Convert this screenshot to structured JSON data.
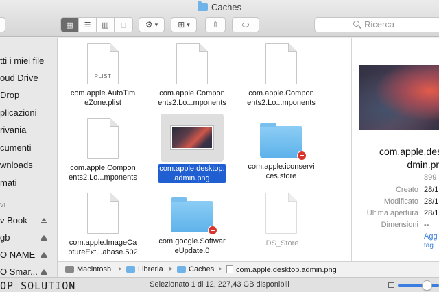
{
  "window": {
    "title": "Caches"
  },
  "toolbar": {
    "view_icons": "▦",
    "view_list": "☰",
    "view_columns": "▥",
    "view_coverflow": "⊟",
    "action_icon": "⚙",
    "action_chevron": "▾",
    "arrange_icon": "⊞",
    "arrange_chevron": "▾",
    "share_icon": "⇧",
    "tag_icon": "⬭",
    "search_placeholder": "Ricerca"
  },
  "sidebar": {
    "items": [
      {
        "label": "tti i miei file"
      },
      {
        "label": "oud Drive"
      },
      {
        "label": "Drop"
      },
      {
        "label": "plicazioni"
      },
      {
        "label": "rivania"
      },
      {
        "label": "cumenti"
      },
      {
        "label": "wnloads"
      },
      {
        "label": "mati"
      }
    ],
    "section_devices": "vi",
    "devices": [
      {
        "label": "v Book"
      },
      {
        "label": "gb"
      },
      {
        "label": "O NAME"
      },
      {
        "label": "O Smar..."
      }
    ]
  },
  "files": [
    {
      "label": "com.apple.AutoTimeZone.plist",
      "line1": "com.apple.AutoTim",
      "line2": "eZone.plist",
      "kind": "plist",
      "tag": "PLIST"
    },
    {
      "label": "com.apple.Components2.Lo...mponents",
      "line1": "com.apple.Compon",
      "line2": "ents2.Lo...mponents",
      "kind": "doc"
    },
    {
      "label": "com.apple.Components2.Lo...mponents",
      "line1": "com.apple.Compon",
      "line2": "ents2.Lo...mponents",
      "kind": "doc"
    },
    {
      "label": "com.apple.Components2.Lo...mponents",
      "line1": "com.apple.Compon",
      "line2": "ents2.Lo...mponents",
      "kind": "doc"
    },
    {
      "label": "com.apple.desktop.admin.png",
      "line1": "com.apple.desktop.",
      "line2": "admin.png",
      "kind": "image",
      "selected": true
    },
    {
      "label": "com.apple.iconservices.store",
      "line1": "com.apple.iconservi",
      "line2": "ces.store",
      "kind": "folder-restricted"
    },
    {
      "label": "com.apple.ImageCaptureExt...abase.502",
      "line1": "com.apple.ImageCa",
      "line2": "ptureExt...abase.502",
      "kind": "doc"
    },
    {
      "label": "com.google.SoftwareUpdate.0",
      "line1": "com.google.Softwar",
      "line2": "eUpdate.0",
      "kind": "folder-restricted"
    },
    {
      "label": ".DS_Store",
      "line1": ".DS_Store",
      "line2": "",
      "kind": "doc",
      "dim": true
    }
  ],
  "preview": {
    "name_line1": "com.apple.desk",
    "name_line2": "dmin.png",
    "size": "899",
    "rows": [
      {
        "key": "Creato",
        "value": "28/1"
      },
      {
        "key": "Modificato",
        "value": "28/1"
      },
      {
        "key": "Ultima apertura",
        "value": "28/1"
      },
      {
        "key": "Dimensioni",
        "value": "--"
      }
    ],
    "link": "Agg",
    "link2": "tag"
  },
  "pathbar": {
    "crumbs": [
      "Macintosh",
      "Libreria",
      "Caches",
      "com.apple.desktop.admin.png"
    ],
    "separator": "▸"
  },
  "status": {
    "text": "Selezionato 1 di 12, 227,43 GB disponibili",
    "watermark": "OP SOLUTION",
    "icon_zoom_fraction": 0.6
  },
  "colors": {
    "selection": "#1f5fd1",
    "folder": "#6fb3e8",
    "restricted_badge": "#d9352c",
    "slider": "#3b7de0"
  }
}
